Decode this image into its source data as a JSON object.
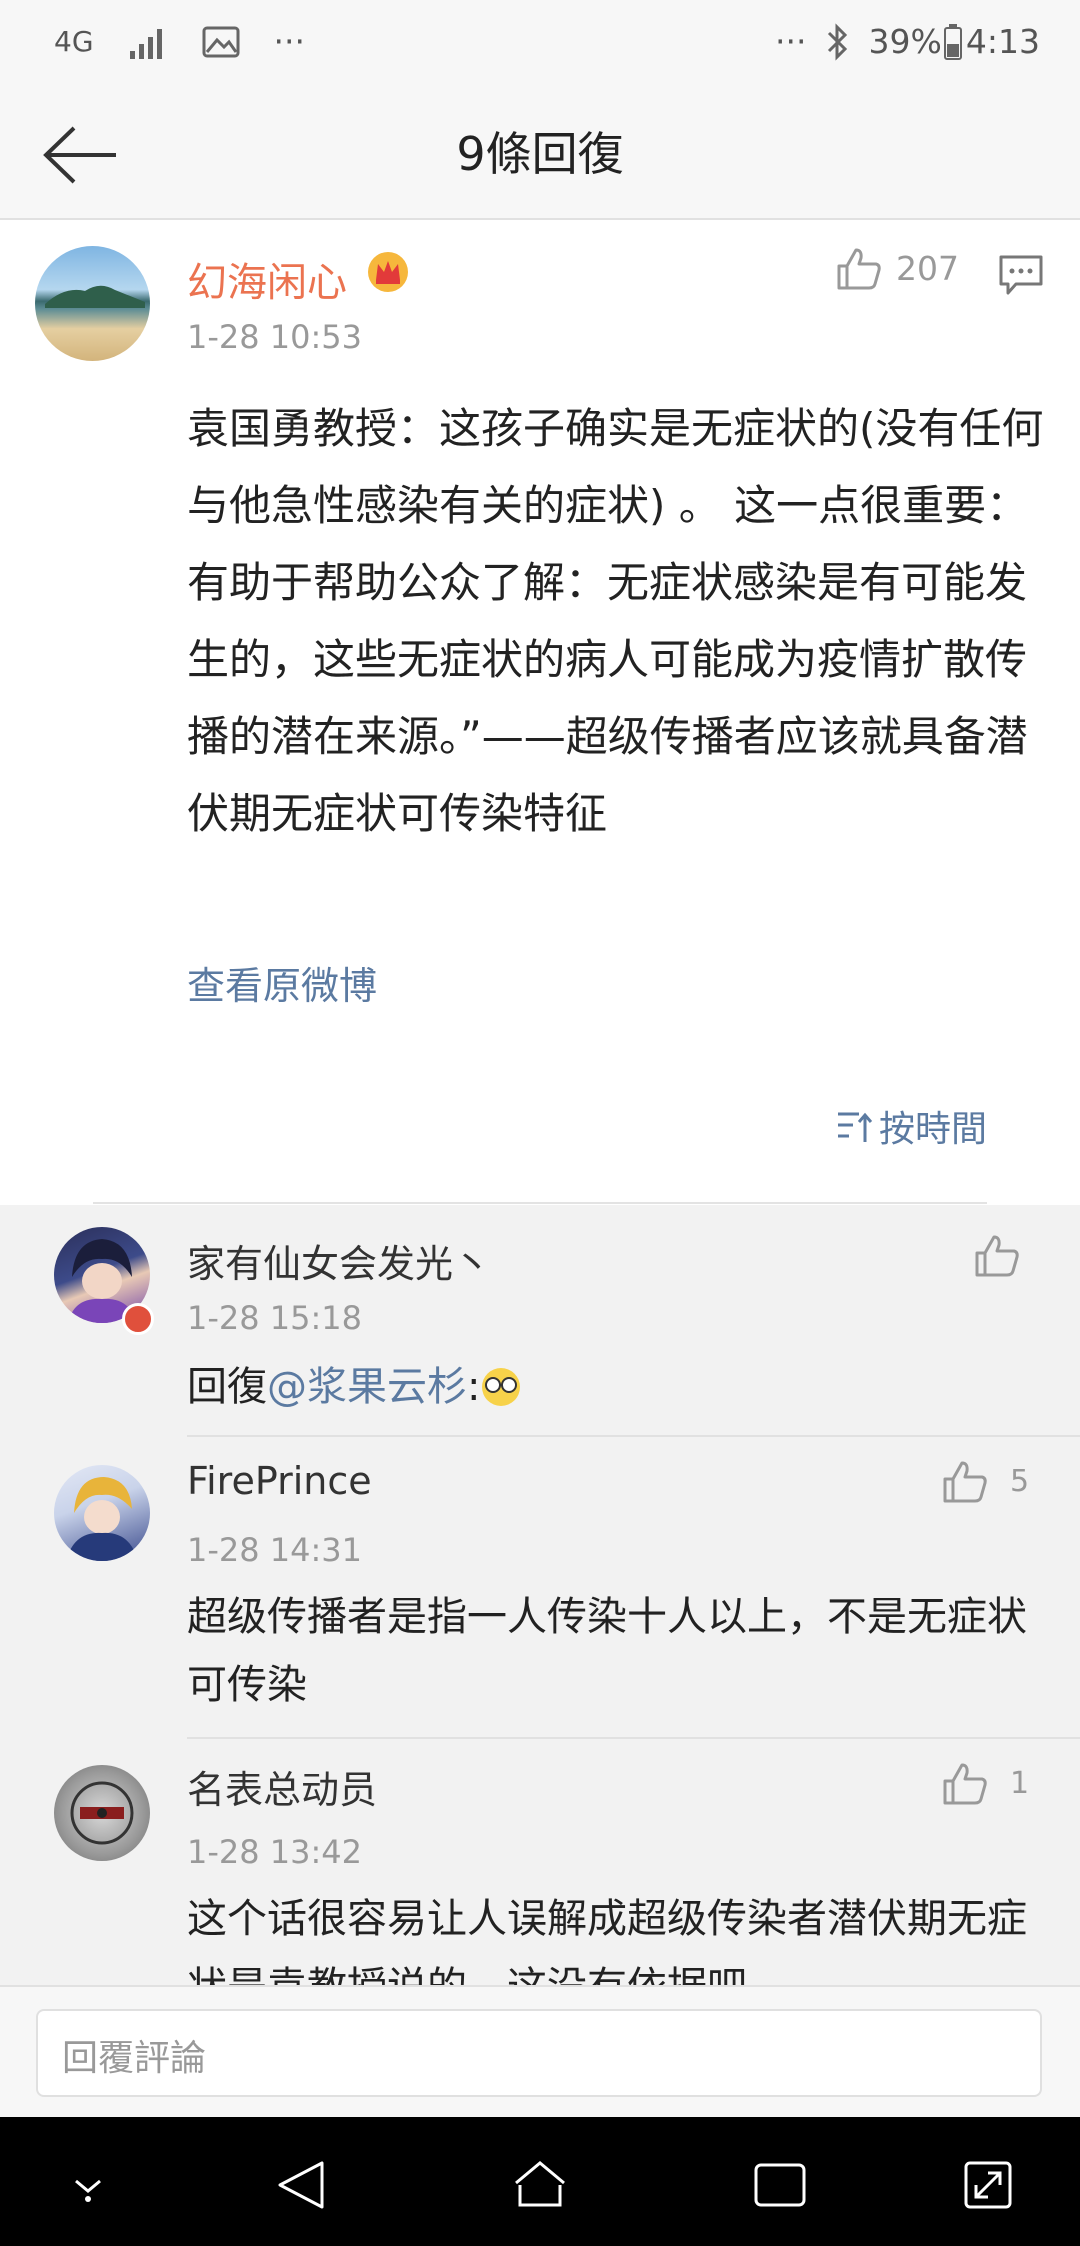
{
  "status_bar": {
    "network": "4G",
    "more": "···",
    "battery": "39%",
    "time": "4:13"
  },
  "header": {
    "title": "9條回復"
  },
  "post": {
    "author": "幻海闲心",
    "time": "1-28 10:53",
    "likes": "207",
    "text": "袁国勇教授：这孩子确实是无症状的(没有任何与他急性感染有关的症状) 。 这一点很重要：有助于帮助公众了解：无症状感染是有可能发生的，这些无症状的病人可能成为疫情扩散传播的潜在来源。”——超级传播者应该就具备潜伏期无症状可传染特征",
    "view_original": "查看原微博",
    "sort_label": "按時間"
  },
  "comments": [
    {
      "name": "家有仙女会发光丶",
      "time": "1-28 15:18",
      "reply_prefix": "回復",
      "mention": "@浆果云杉",
      "suffix": ":",
      "likes": ""
    },
    {
      "name": "FirePrince",
      "time": "1-28 14:31",
      "text": "超级传播者是指一人传染十人以上，不是无症状可传染",
      "likes": "5"
    },
    {
      "name": "名表总动员",
      "time": "1-28 13:42",
      "text": "这个话很容易让人误解成超级传染者潜伏期无症状是袁教授说的，这没有依据吧。",
      "likes": "1"
    }
  ],
  "reply_bar": {
    "placeholder": "回覆評論"
  },
  "colors": {
    "accent": "#eb7350",
    "link": "#5b7aa1",
    "muted": "#999999"
  }
}
